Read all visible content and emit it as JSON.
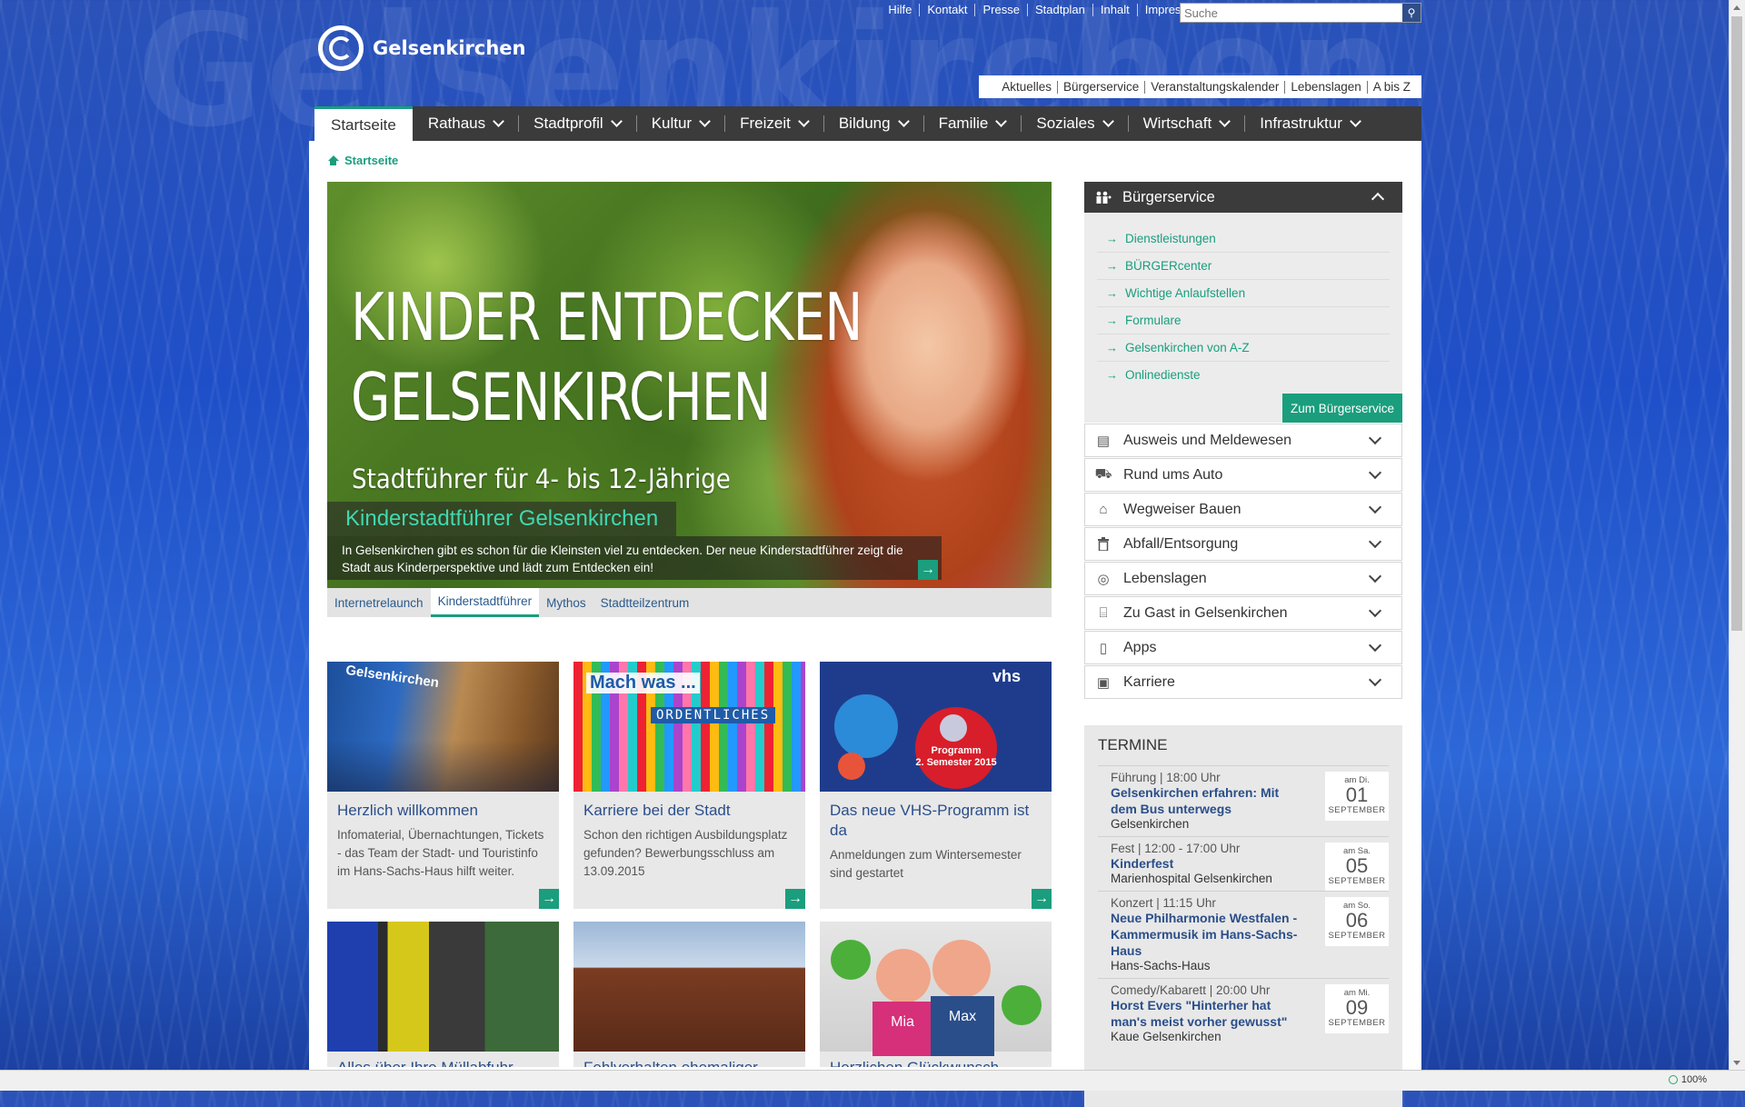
{
  "brand": {
    "name": "Gelsenkirchen",
    "watermark": "Gelsenkirchen"
  },
  "toplinks": [
    "Hilfe",
    "Kontakt",
    "Presse",
    "Stadtplan",
    "Inhalt",
    "Impressum"
  ],
  "search": {
    "placeholder": "Suche",
    "icon": "search-icon"
  },
  "quicklinks": [
    "Aktuelles",
    "Bürgerservice",
    "Veranstaltungskalender",
    "Lebenslagen",
    "A bis Z"
  ],
  "nav": [
    {
      "label": "Startseite",
      "active": true
    },
    {
      "label": "Rathaus"
    },
    {
      "label": "Stadtprofil"
    },
    {
      "label": "Kultur"
    },
    {
      "label": "Freizeit"
    },
    {
      "label": "Bildung"
    },
    {
      "label": "Familie"
    },
    {
      "label": "Soziales"
    },
    {
      "label": "Wirtschaft"
    },
    {
      "label": "Infrastruktur"
    }
  ],
  "breadcrumb": {
    "label": "Startseite"
  },
  "hero": {
    "title_line1": "KINDER ENTDECKEN",
    "title_line2": "GELSENKIRCHEN",
    "subtitle": "Stadtführer für 4- bis 12-Jährige",
    "caption": "Kinderstadtführer Gelsenkirchen",
    "text": "In Gelsenkirchen gibt es schon für die Kleinsten viel zu entdecken. Der neue Kinderstadtführer zeigt die Stadt aus Kinderperspektive und lädt zum Entdecken ein!",
    "tabs": [
      "Internetrelaunch",
      "Kinderstadtführer",
      "Mythos",
      "Stadtteilzentrum"
    ],
    "active_tab": "Kinderstadtführer"
  },
  "cards": [
    {
      "title": "Herzlich willkommen",
      "text": "Infomaterial, Übernachtungen, Tickets - das Team der Stadt- und Touristinfo im Hans-Sachs-Haus hilft weiter.",
      "img_text": "Gelsenkirchen"
    },
    {
      "title": "Karriere bei der Stadt",
      "text": "Schon den richtigen Ausbildungsplatz gefunden? Bewerbungsschluss am 13.09.2015",
      "img_text_1": "Mach was ...",
      "img_text_2": "ORDENTLICHES"
    },
    {
      "title": "Das neue VHS-Programm ist da",
      "text": "Anmeldungen zum Wintersemester sind gestartet",
      "img_logo": "vhs",
      "img_text_1": "Programm",
      "img_text_2": "2. Semester 2015"
    }
  ],
  "cards_row2": [
    {
      "title": "Alles über Ihre Müllabfuhr"
    },
    {
      "title": "Fehlverhalten ehemaliger"
    },
    {
      "title": "Herzlichen Glückwunsch",
      "img_labels": [
        "Mia",
        "Max"
      ]
    }
  ],
  "buergerservice": {
    "title": "Bürgerservice",
    "links": [
      "Dienstleistungen",
      "BÜRGERcenter",
      "Wichtige Anlaufstellen",
      "Formulare",
      "Gelsenkirchen von A-Z",
      "Onlinedienste"
    ],
    "button": "Zum Bürgerservice"
  },
  "accordion": [
    {
      "label": "Ausweis und Meldewesen",
      "icon": "id-card-icon",
      "glyph": "▤"
    },
    {
      "label": "Rund ums Auto",
      "icon": "car-icon",
      "glyph": "⛟"
    },
    {
      "label": "Wegweiser Bauen",
      "icon": "house-icon",
      "glyph": "⌂"
    },
    {
      "label": "Abfall/Entsorgung",
      "icon": "trash-icon",
      "glyph": "🗑"
    },
    {
      "label": "Lebenslagen",
      "icon": "lifebuoy-icon",
      "glyph": "◎"
    },
    {
      "label": "Zu Gast in Gelsenkirchen",
      "icon": "bed-icon",
      "glyph": "⌸"
    },
    {
      "label": "Apps",
      "icon": "smartphone-icon",
      "glyph": "▯"
    },
    {
      "label": "Karriere",
      "icon": "briefcase-icon",
      "glyph": "▣"
    }
  ],
  "termine": {
    "heading": "TERMINE",
    "events": [
      {
        "meta": "Führung | 18:00 Uhr",
        "title": "Gelsenkirchen erfahren: Mit dem Bus unterwegs",
        "location": "Gelsenkirchen",
        "weekday": "am Di.",
        "day": "01",
        "month": "SEPTEMBER"
      },
      {
        "meta": "Fest | 12:00 - 17:00 Uhr",
        "title": "Kinderfest",
        "location": "Marienhospital Gelsenkirchen",
        "weekday": "am Sa.",
        "day": "05",
        "month": "SEPTEMBER"
      },
      {
        "meta": "Konzert | 11:15 Uhr",
        "title": "Neue Philharmonie Westfalen - Kammermusik im Hans-Sachs-Haus",
        "location": "Hans-Sachs-Haus",
        "weekday": "am So.",
        "day": "06",
        "month": "SEPTEMBER"
      },
      {
        "meta": "Comedy/Kabarett | 20:00 Uhr",
        "title": "Horst Evers \"Hinterher hat man's meist vorher gewusst\"",
        "location": "Kaue Gelsenkirchen",
        "weekday": "am Mi.",
        "day": "09",
        "month": "SEPTEMBER"
      }
    ]
  },
  "status": {
    "zoom": "100%"
  },
  "colors": {
    "accent": "#1a9e7d",
    "nav_bg": "#3b3b3b",
    "link": "#2a4e8a"
  }
}
